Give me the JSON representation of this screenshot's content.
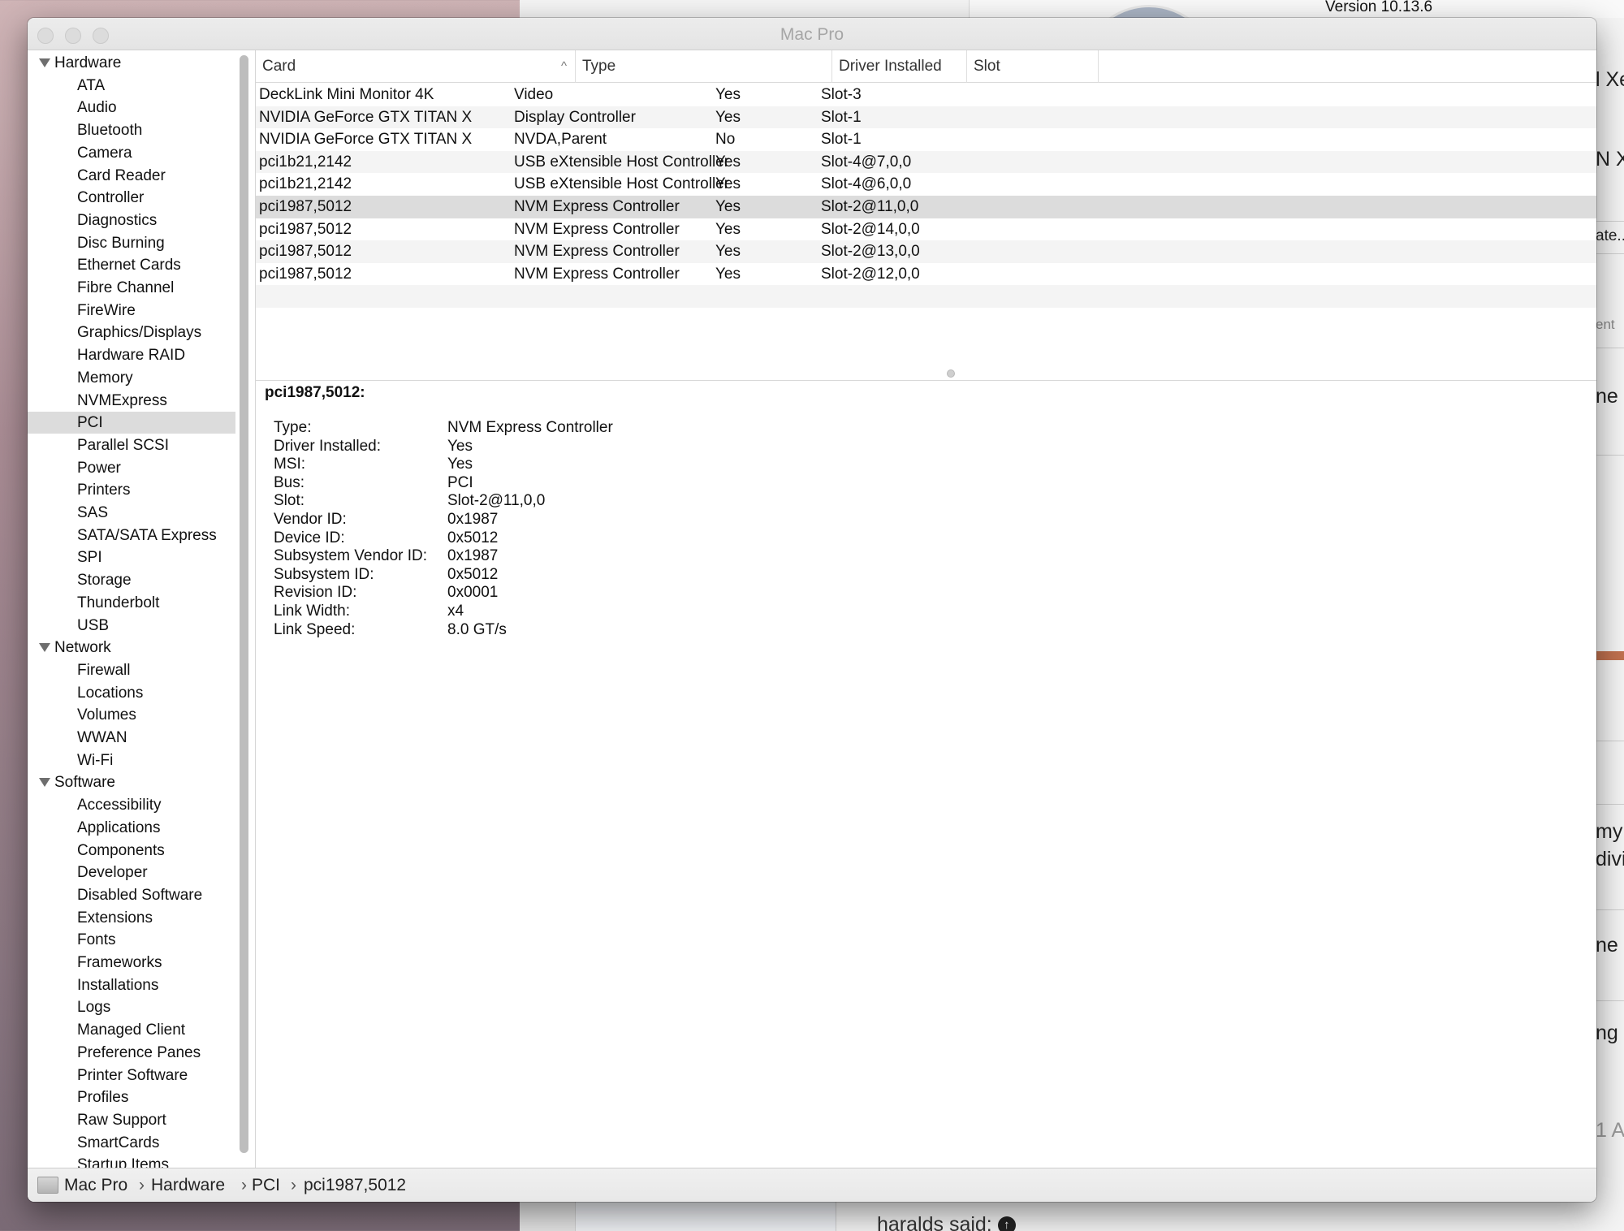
{
  "background": {
    "version_text": "Version 10.13.6",
    "snippets": [
      "l Xe",
      "N X",
      "ate...",
      "ent",
      "ne",
      "my",
      "divi",
      "ne",
      "ng",
      "1 A"
    ],
    "forum_text": "haralds said:"
  },
  "window": {
    "title": "Mac Pro"
  },
  "sidebar": {
    "groups": [
      {
        "label": "Hardware",
        "items": [
          "ATA",
          "Audio",
          "Bluetooth",
          "Camera",
          "Card Reader",
          "Controller",
          "Diagnostics",
          "Disc Burning",
          "Ethernet Cards",
          "Fibre Channel",
          "FireWire",
          "Graphics/Displays",
          "Hardware RAID",
          "Memory",
          "NVMExpress",
          "PCI",
          "Parallel SCSI",
          "Power",
          "Printers",
          "SAS",
          "SATA/SATA Express",
          "SPI",
          "Storage",
          "Thunderbolt",
          "USB"
        ]
      },
      {
        "label": "Network",
        "items": [
          "Firewall",
          "Locations",
          "Volumes",
          "WWAN",
          "Wi-Fi"
        ]
      },
      {
        "label": "Software",
        "items": [
          "Accessibility",
          "Applications",
          "Components",
          "Developer",
          "Disabled Software",
          "Extensions",
          "Fonts",
          "Frameworks",
          "Installations",
          "Logs",
          "Managed Client",
          "Preference Panes",
          "Printer Software",
          "Profiles",
          "Raw Support",
          "SmartCards",
          "Startup Items"
        ]
      }
    ],
    "selected": "PCI"
  },
  "table": {
    "columns": [
      "Card",
      "Type",
      "Driver Installed",
      "Slot"
    ],
    "sort_indicator": "^",
    "rows": [
      [
        "DeckLink Mini Monitor 4K",
        "Video",
        "Yes",
        "Slot-3"
      ],
      [
        "NVIDIA GeForce GTX TITAN X",
        "Display Controller",
        "Yes",
        "Slot-1"
      ],
      [
        "NVIDIA GeForce GTX TITAN X",
        "NVDA,Parent",
        "No",
        "Slot-1"
      ],
      [
        "pci1b21,2142",
        "USB eXtensible Host Controller",
        "Yes",
        "Slot-4@7,0,0"
      ],
      [
        "pci1b21,2142",
        "USB eXtensible Host Controller",
        "Yes",
        "Slot-4@6,0,0"
      ],
      [
        "pci1987,5012",
        "NVM Express Controller",
        "Yes",
        "Slot-2@11,0,0"
      ],
      [
        "pci1987,5012",
        "NVM Express Controller",
        "Yes",
        "Slot-2@14,0,0"
      ],
      [
        "pci1987,5012",
        "NVM Express Controller",
        "Yes",
        "Slot-2@13,0,0"
      ],
      [
        "pci1987,5012",
        "NVM Express Controller",
        "Yes",
        "Slot-2@12,0,0"
      ]
    ],
    "selected_row": 5
  },
  "detail": {
    "title": "pci1987,5012:",
    "properties": [
      {
        "label": "Type:",
        "value": "NVM Express Controller"
      },
      {
        "label": "Driver Installed:",
        "value": "Yes"
      },
      {
        "label": "MSI:",
        "value": "Yes"
      },
      {
        "label": "Bus:",
        "value": "PCI"
      },
      {
        "label": "Slot:",
        "value": "Slot-2@11,0,0"
      },
      {
        "label": "Vendor ID:",
        "value": "0x1987"
      },
      {
        "label": "Device ID:",
        "value": "0x5012"
      },
      {
        "label": "Subsystem Vendor ID:",
        "value": "0x1987"
      },
      {
        "label": "Subsystem ID:",
        "value": "0x5012"
      },
      {
        "label": "Revision ID:",
        "value": "0x0001"
      },
      {
        "label": "Link Width:",
        "value": "x4"
      },
      {
        "label": "Link Speed:",
        "value": "8.0 GT/s"
      }
    ]
  },
  "pathbar": {
    "crumbs": [
      "Mac Pro",
      "Hardware",
      "PCI",
      "pci1987,5012"
    ],
    "separator": "›"
  }
}
